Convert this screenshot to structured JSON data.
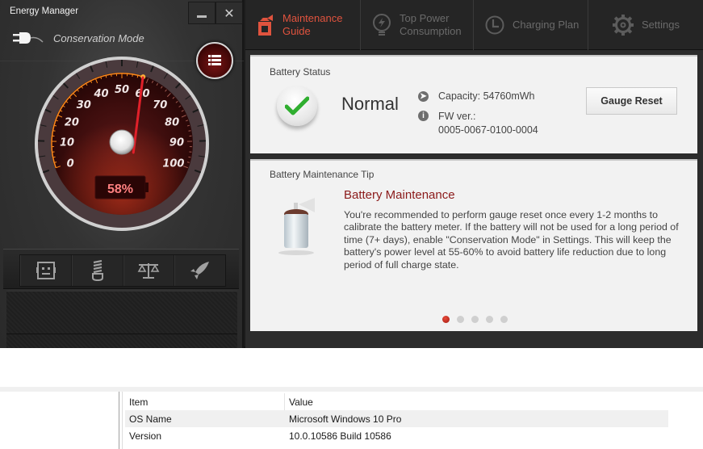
{
  "window": {
    "title": "Energy Manager",
    "minimize_icon": "minimize-icon",
    "close_icon": "close-icon"
  },
  "left_panel": {
    "mode_label": "Conservation Mode",
    "mode_icon": "power-plug-icon",
    "menu_icon": "list-menu-icon",
    "gauge": {
      "tick_labels": [
        "0",
        "10",
        "20",
        "30",
        "40",
        "50",
        "60",
        "70",
        "80",
        "90",
        "100"
      ],
      "level_percent": 58,
      "display_text": "58%"
    },
    "mode_buttons": [
      {
        "name": "quiet-mode",
        "icon": "robot-face-icon"
      },
      {
        "name": "energy-saving-mode",
        "icon": "cfl-bulb-icon"
      },
      {
        "name": "balanced-mode",
        "icon": "scales-icon"
      },
      {
        "name": "performance-mode",
        "icon": "rocket-icon"
      }
    ]
  },
  "tabs": [
    {
      "label_line1": "Maintenance",
      "label_line2": "Guide",
      "icon": "spray-bottle-icon",
      "active": true
    },
    {
      "label_line1": "Top Power",
      "label_line2": "Consumption",
      "icon": "lightbulb-bolt-icon",
      "active": false
    },
    {
      "label_line1": "Charging Plan",
      "label_line2": "",
      "icon": "clock-icon",
      "active": false
    },
    {
      "label_line1": "Settings",
      "label_line2": "",
      "icon": "gear-icon",
      "active": false
    }
  ],
  "battery_status": {
    "title": "Battery Status",
    "status": "Normal",
    "status_icon": "checkmark-icon",
    "capacity_label": "Capacity: 54760mWh",
    "fw_label": "FW ver.:",
    "fw_value": "0005-0067-0100-0004",
    "gauge_reset_label": "Gauge Reset"
  },
  "maintenance_tip": {
    "title": "Battery Maintenance Tip",
    "heading": "Battery Maintenance",
    "body": "You're recommended to perform gauge reset once every 1-2 months to calibrate the battery meter. If the battery will not be used for a long period of time (7+ days), enable \"Conservation Mode\" in Settings. This will keep the battery's power level at 55-60% to avoid battery life reduction due to long period of full charge state.",
    "page_count": 5,
    "active_page": 1
  },
  "colors": {
    "accent": "#e0533e",
    "heading_red": "#8b1a1a",
    "needle": "#e0202a",
    "gauge_orange": "#ff8a1a"
  },
  "system_info": {
    "headers": [
      "Item",
      "Value"
    ],
    "rows": [
      [
        "OS Name",
        "Microsoft Windows 10 Pro"
      ],
      [
        "Version",
        "10.0.10586 Build 10586"
      ]
    ]
  }
}
